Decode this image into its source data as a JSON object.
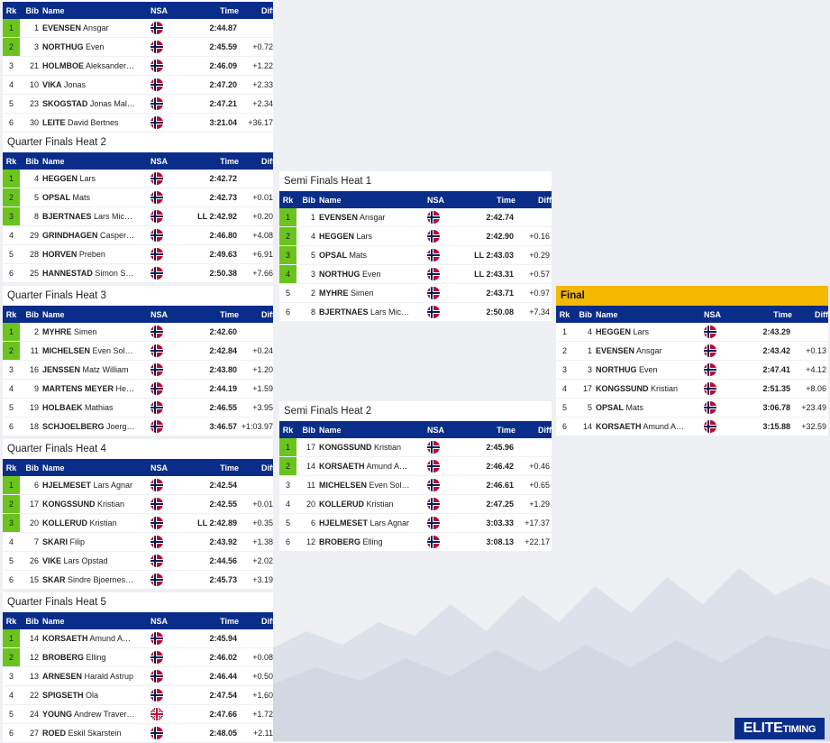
{
  "header": {
    "rk": "Rk",
    "bib": "Bib",
    "name": "Name",
    "nsa": "NSA",
    "time": "Time",
    "diff": "Diff"
  },
  "heats": [
    {
      "title": "",
      "rows": [
        {
          "rk": "1",
          "bib": "1",
          "last": "EVENSEN",
          "first": "Ansgar",
          "nsa": "NOR",
          "time": "2:44.87",
          "diff": "",
          "q": true
        },
        {
          "rk": "2",
          "bib": "3",
          "last": "NORTHUG",
          "first": "Even",
          "nsa": "NOR",
          "time": "2:45.59",
          "diff": "+0.72",
          "q": true
        },
        {
          "rk": "3",
          "bib": "21",
          "last": "HOLMBOE",
          "first": "Aleksander…",
          "nsa": "NOR",
          "time": "2:46.09",
          "diff": "+1.22",
          "q": false
        },
        {
          "rk": "4",
          "bib": "10",
          "last": "VIKA",
          "first": "Jonas",
          "nsa": "NOR",
          "time": "2:47.20",
          "diff": "+2.33",
          "q": false
        },
        {
          "rk": "5",
          "bib": "23",
          "last": "SKOGSTAD",
          "first": "Jonas Mal…",
          "nsa": "NOR",
          "time": "2:47.21",
          "diff": "+2.34",
          "q": false
        },
        {
          "rk": "6",
          "bib": "30",
          "last": "LEITE",
          "first": "David Bertnes",
          "nsa": "NOR",
          "time": "3:21.04",
          "diff": "+36.17",
          "q": false
        }
      ]
    },
    {
      "title": "Quarter Finals Heat 2",
      "rows": [
        {
          "rk": "1",
          "bib": "4",
          "last": "HEGGEN",
          "first": "Lars",
          "nsa": "NOR",
          "time": "2:42.72",
          "diff": "",
          "q": true
        },
        {
          "rk": "2",
          "bib": "5",
          "last": "OPSAL",
          "first": "Mats",
          "nsa": "NOR",
          "time": "2:42.73",
          "diff": "+0.01",
          "q": true
        },
        {
          "rk": "3",
          "bib": "8",
          "last": "BJERTNAES",
          "first": "Lars Mic…",
          "nsa": "NOR",
          "time": "LL 2:42.92",
          "diff": "+0.20",
          "q": true
        },
        {
          "rk": "4",
          "bib": "29",
          "last": "GRINDHAGEN",
          "first": "Casper…",
          "nsa": "NOR",
          "time": "2:46.80",
          "diff": "+4.08",
          "q": false
        },
        {
          "rk": "5",
          "bib": "28",
          "last": "HORVEN",
          "first": "Preben",
          "nsa": "NOR",
          "time": "2:49.63",
          "diff": "+6.91",
          "q": false
        },
        {
          "rk": "6",
          "bib": "25",
          "last": "HANNESTAD",
          "first": "Simon S…",
          "nsa": "NOR",
          "time": "2:50.38",
          "diff": "+7.66",
          "q": false
        }
      ]
    },
    {
      "title": "Quarter Finals Heat 3",
      "rows": [
        {
          "rk": "1",
          "bib": "2",
          "last": "MYHRE",
          "first": "Simen",
          "nsa": "NOR",
          "time": "2:42.60",
          "diff": "",
          "q": true
        },
        {
          "rk": "2",
          "bib": "11",
          "last": "MICHELSEN",
          "first": "Even Sol…",
          "nsa": "NOR",
          "time": "2:42.84",
          "diff": "+0.24",
          "q": true
        },
        {
          "rk": "3",
          "bib": "16",
          "last": "JENSSEN",
          "first": "Matz William",
          "nsa": "NOR",
          "time": "2:43.80",
          "diff": "+1.20",
          "q": false
        },
        {
          "rk": "4",
          "bib": "9",
          "last": "MARTENS MEYER",
          "first": "He…",
          "nsa": "NOR",
          "time": "2:44.19",
          "diff": "+1.59",
          "q": false
        },
        {
          "rk": "5",
          "bib": "19",
          "last": "HOLBAEK",
          "first": "Mathias",
          "nsa": "NOR",
          "time": "2:46.55",
          "diff": "+3.95",
          "q": false
        },
        {
          "rk": "6",
          "bib": "18",
          "last": "SCHJOELBERG",
          "first": "Joerg…",
          "nsa": "NOR",
          "time": "3:46.57",
          "diff": "+1:03.97",
          "q": false
        }
      ]
    },
    {
      "title": "Quarter Finals Heat 4",
      "rows": [
        {
          "rk": "1",
          "bib": "6",
          "last": "HJELMESET",
          "first": "Lars Agnar",
          "nsa": "NOR",
          "time": "2:42.54",
          "diff": "",
          "q": true
        },
        {
          "rk": "2",
          "bib": "17",
          "last": "KONGSSUND",
          "first": "Kristian",
          "nsa": "NOR",
          "time": "2:42.55",
          "diff": "+0.01",
          "q": true
        },
        {
          "rk": "3",
          "bib": "20",
          "last": "KOLLERUD",
          "first": "Kristian",
          "nsa": "NOR",
          "time": "LL 2:42.89",
          "diff": "+0.35",
          "q": true
        },
        {
          "rk": "4",
          "bib": "7",
          "last": "SKARI",
          "first": "Filip",
          "nsa": "NOR",
          "time": "2:43.92",
          "diff": "+1.38",
          "q": false
        },
        {
          "rk": "5",
          "bib": "26",
          "last": "VIKE",
          "first": "Lars Opstad",
          "nsa": "NOR",
          "time": "2:44.56",
          "diff": "+2.02",
          "q": false
        },
        {
          "rk": "6",
          "bib": "15",
          "last": "SKAR",
          "first": "Sindre Bjoernes…",
          "nsa": "NOR",
          "time": "2:45.73",
          "diff": "+3.19",
          "q": false
        }
      ]
    },
    {
      "title": "Quarter Finals Heat 5",
      "rows": [
        {
          "rk": "1",
          "bib": "14",
          "last": "KORSAETH",
          "first": "Amund A…",
          "nsa": "NOR",
          "time": "2:45.94",
          "diff": "",
          "q": true
        },
        {
          "rk": "2",
          "bib": "12",
          "last": "BROBERG",
          "first": "Elling",
          "nsa": "NOR",
          "time": "2:46.02",
          "diff": "+0.08",
          "q": true
        },
        {
          "rk": "3",
          "bib": "13",
          "last": "ARNESEN",
          "first": "Harald Astrup",
          "nsa": "NOR",
          "time": "2:46.44",
          "diff": "+0.50",
          "q": false
        },
        {
          "rk": "4",
          "bib": "22",
          "last": "SPIGSETH",
          "first": "Ola",
          "nsa": "NOR",
          "time": "2:47.54",
          "diff": "+1.60",
          "q": false
        },
        {
          "rk": "5",
          "bib": "24",
          "last": "YOUNG",
          "first": "Andrew Traver…",
          "nsa": "GBR",
          "time": "2:47.66",
          "diff": "+1.72",
          "q": false
        },
        {
          "rk": "6",
          "bib": "27",
          "last": "ROED",
          "first": "Eskil Skarstein",
          "nsa": "NOR",
          "time": "2:48.05",
          "diff": "+2.11",
          "q": false
        }
      ]
    },
    {
      "title": "Semi Finals Heat 1",
      "rows": [
        {
          "rk": "1",
          "bib": "1",
          "last": "EVENSEN",
          "first": "Ansgar",
          "nsa": "NOR",
          "time": "2:42.74",
          "diff": "",
          "q": true
        },
        {
          "rk": "2",
          "bib": "4",
          "last": "HEGGEN",
          "first": "Lars",
          "nsa": "NOR",
          "time": "2:42.90",
          "diff": "+0.16",
          "q": true
        },
        {
          "rk": "3",
          "bib": "5",
          "last": "OPSAL",
          "first": "Mats",
          "nsa": "NOR",
          "time": "LL 2:43.03",
          "diff": "+0.29",
          "q": true
        },
        {
          "rk": "4",
          "bib": "3",
          "last": "NORTHUG",
          "first": "Even",
          "nsa": "NOR",
          "time": "LL 2:43.31",
          "diff": "+0.57",
          "q": true
        },
        {
          "rk": "5",
          "bib": "2",
          "last": "MYHRE",
          "first": "Simen",
          "nsa": "NOR",
          "time": "2:43.71",
          "diff": "+0.97",
          "q": false
        },
        {
          "rk": "6",
          "bib": "8",
          "last": "BJERTNAES",
          "first": "Lars Mic…",
          "nsa": "NOR",
          "time": "2:50.08",
          "diff": "+7.34",
          "q": false
        }
      ]
    },
    {
      "title": "Semi Finals Heat 2",
      "rows": [
        {
          "rk": "1",
          "bib": "17",
          "last": "KONGSSUND",
          "first": "Kristian",
          "nsa": "NOR",
          "time": "2:45.96",
          "diff": "",
          "q": true
        },
        {
          "rk": "2",
          "bib": "14",
          "last": "KORSAETH",
          "first": "Amund A…",
          "nsa": "NOR",
          "time": "2:46.42",
          "diff": "+0.46",
          "q": true
        },
        {
          "rk": "3",
          "bib": "11",
          "last": "MICHELSEN",
          "first": "Even Sol…",
          "nsa": "NOR",
          "time": "2:46.61",
          "diff": "+0.65",
          "q": false
        },
        {
          "rk": "4",
          "bib": "20",
          "last": "KOLLERUD",
          "first": "Kristian",
          "nsa": "NOR",
          "time": "2:47.25",
          "diff": "+1.29",
          "q": false
        },
        {
          "rk": "5",
          "bib": "6",
          "last": "HJELMESET",
          "first": "Lars Agnar",
          "nsa": "NOR",
          "time": "3:03.33",
          "diff": "+17.37",
          "q": false
        },
        {
          "rk": "6",
          "bib": "12",
          "last": "BROBERG",
          "first": "Elling",
          "nsa": "NOR",
          "time": "3:08.13",
          "diff": "+22.17",
          "q": false
        }
      ]
    },
    {
      "title": "Final",
      "rows": [
        {
          "rk": "1",
          "bib": "4",
          "last": "HEGGEN",
          "first": "Lars",
          "nsa": "NOR",
          "time": "2:43.29",
          "diff": "",
          "q": false
        },
        {
          "rk": "2",
          "bib": "1",
          "last": "EVENSEN",
          "first": "Ansgar",
          "nsa": "NOR",
          "time": "2:43.42",
          "diff": "+0.13",
          "q": false
        },
        {
          "rk": "3",
          "bib": "3",
          "last": "NORTHUG",
          "first": "Even",
          "nsa": "NOR",
          "time": "2:47.41",
          "diff": "+4.12",
          "q": false
        },
        {
          "rk": "4",
          "bib": "17",
          "last": "KONGSSUND",
          "first": "Kristian",
          "nsa": "NOR",
          "time": "2:51.35",
          "diff": "+8.06",
          "q": false
        },
        {
          "rk": "5",
          "bib": "5",
          "last": "OPSAL",
          "first": "Mats",
          "nsa": "NOR",
          "time": "3:06.78",
          "diff": "+23.49",
          "q": false
        },
        {
          "rk": "6",
          "bib": "14",
          "last": "KORSAETH",
          "first": "Amund A…",
          "nsa": "NOR",
          "time": "3:15.88",
          "diff": "+32.59",
          "q": false
        }
      ]
    }
  ],
  "logo": {
    "text_big": "ELITE",
    "text_small": "TIMING"
  },
  "colors": {
    "header_bg": "#0a2d8a",
    "qualified": "#6bc41e",
    "final_title_bg": "#f5b800"
  }
}
